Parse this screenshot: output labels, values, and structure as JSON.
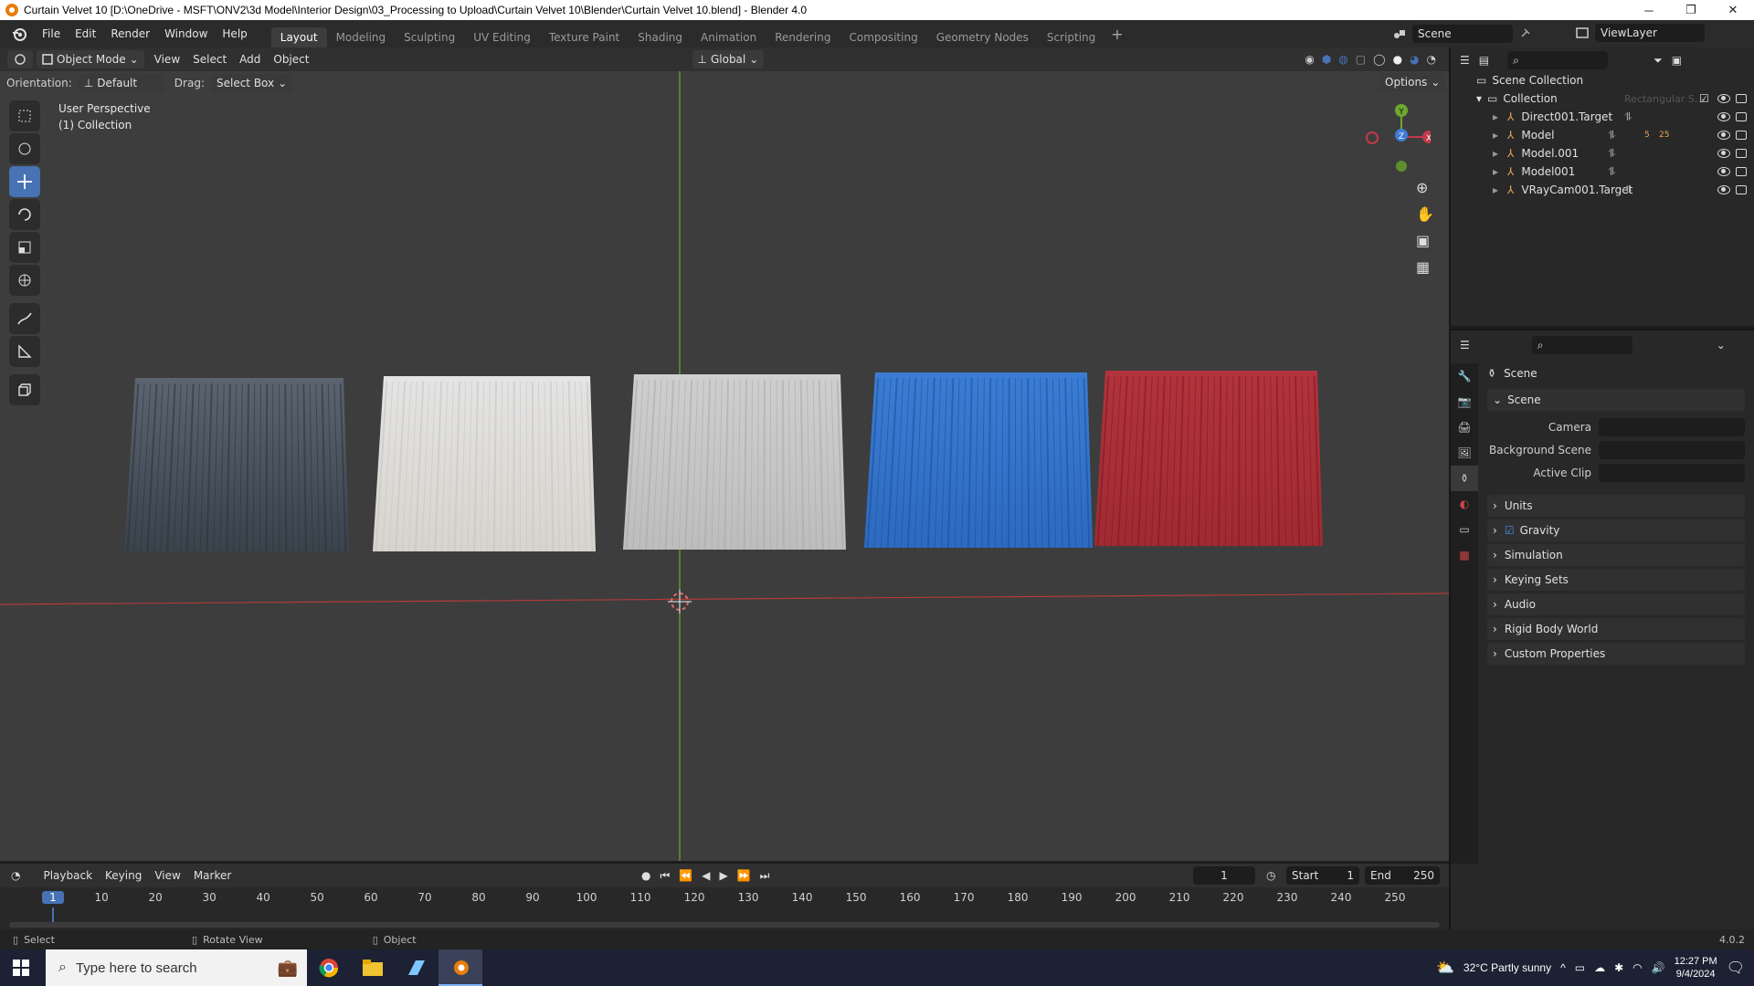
{
  "window": {
    "title": "Curtain Velvet 10 [D:\\OneDrive - MSFT\\ONV2\\3d Model\\Interior Design\\03_Processing to Upload\\Curtain Velvet 10\\Blender\\Curtain Velvet 10.blend] - Blender 4.0",
    "minimize": "─",
    "restore": "❐",
    "close": "✕"
  },
  "menu": [
    "File",
    "Edit",
    "Render",
    "Window",
    "Help"
  ],
  "workspaces": [
    "Layout",
    "Modeling",
    "Sculpting",
    "UV Editing",
    "Texture Paint",
    "Shading",
    "Animation",
    "Rendering",
    "Compositing",
    "Geometry Nodes",
    "Scripting"
  ],
  "workspace_add": "+",
  "active_workspace": "Layout",
  "scene_selector": "Scene",
  "viewlayer_selector": "ViewLayer",
  "header": {
    "mode": "Object Mode",
    "items": [
      "View",
      "Select",
      "Add",
      "Object"
    ],
    "transform_orientation": "Global"
  },
  "tool_settings": {
    "orientation_label": "Orientation:",
    "orientation_value": "Default",
    "drag_label": "Drag:",
    "drag_value": "Select Box",
    "options_label": "Options"
  },
  "viewport": {
    "perspective": "User Perspective",
    "collection": "(1) Collection",
    "gizmo_axes": [
      "Y",
      "Z",
      "X"
    ]
  },
  "curtains": [
    {
      "color_top": "#5b6470",
      "color_bottom": "#3a424c",
      "stripe": "#2b323a"
    },
    {
      "color_top": "#e4e4e4",
      "color_bottom": "#d8d4cc",
      "stripe": "#c4c4c4"
    },
    {
      "color_top": "#cfcfcf",
      "color_bottom": "#bdbdbd",
      "stripe": "#a9a9a9"
    },
    {
      "color_top": "#3b7dd4",
      "color_bottom": "#2d6ac0",
      "stripe": "#1d4f96"
    },
    {
      "color_top": "#b2333c",
      "color_bottom": "#a12a33",
      "stripe": "#7a1a22"
    }
  ],
  "outliner": {
    "root": "Scene Collection",
    "collection": "Collection",
    "hidden_item": "Rectangular S...",
    "items": [
      "Direct001.Target",
      "Model",
      "Model.001",
      "Model001",
      "VRayCam001.Target"
    ],
    "model_counts": [
      "5",
      "25"
    ]
  },
  "properties": {
    "context": "Scene",
    "panel_scene": "Scene",
    "fields": [
      "Camera",
      "Background Scene",
      "Active Clip"
    ],
    "panels": [
      "Units",
      "Gravity",
      "Simulation",
      "Keying Sets",
      "Audio",
      "Rigid Body World",
      "Custom Properties"
    ],
    "gravity_checked": true
  },
  "timeline": {
    "menu": [
      "Playback",
      "Keying",
      "View",
      "Marker"
    ],
    "current_frame": "1",
    "start_label": "Start",
    "start": "1",
    "end_label": "End",
    "end": "250",
    "ticks": [
      "1",
      "10",
      "20",
      "30",
      "40",
      "50",
      "60",
      "70",
      "80",
      "90",
      "100",
      "110",
      "120",
      "130",
      "140",
      "150",
      "160",
      "170",
      "180",
      "190",
      "200",
      "210",
      "220",
      "230",
      "240",
      "250"
    ]
  },
  "statusbar": {
    "select": "Select",
    "rotate": "Rotate View",
    "object": "Object",
    "version": "4.0.2"
  },
  "taskbar": {
    "search_placeholder": "Type here to search",
    "weather": "32°C  Partly sunny",
    "time": "12:27 PM",
    "date": "9/4/2024"
  }
}
